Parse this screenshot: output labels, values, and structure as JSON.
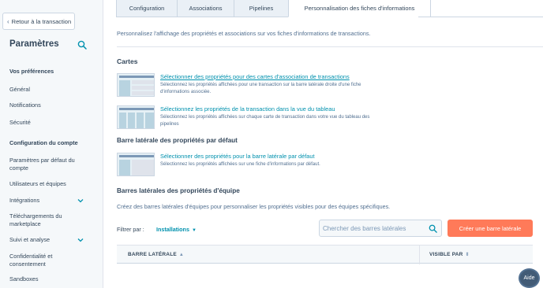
{
  "sidebar": {
    "back_label": "Retour à la transaction",
    "title": "Paramètres",
    "sections": [
      {
        "header": "Vos préférences",
        "items": [
          "Général",
          "Notifications",
          "Sécurité"
        ]
      },
      {
        "header": "Configuration du compte",
        "items": [
          "Paramètres par défaut du compte",
          "Utilisateurs et équipes",
          "Intégrations",
          "Téléchargements du marketplace",
          "Suivi et analyse",
          "Confidentialité et consentement",
          "Sandboxes"
        ]
      }
    ]
  },
  "tabs": [
    "Configuration",
    "Associations",
    "Pipelines",
    "Personnalisation des fiches d'informations"
  ],
  "intro": "Personnalisez l'affichage des propriétés et associations sur vos fiches d'informations de transactions.",
  "cards_section": {
    "title": "Cartes",
    "items": [
      {
        "link": "Sélectionner des propriétés pour des cartes d'association de transactions",
        "desc": "Sélectionnez les propriétés affichées pour une transaction sur la barre latérale droite d'une fiche d'informations associée."
      },
      {
        "link": "Sélectionnez les propriétés de la transaction dans la vue du tableau",
        "desc": "Sélectionnez les propriétés affichées sur chaque carte de transaction dans votre vue du tableau des pipelines"
      }
    ]
  },
  "default_sidebar": {
    "title": "Barre latérale des propriétés par défaut",
    "link": "Sélectionner des propriétés pour la barre latérale par défaut",
    "desc": "Sélectionnez les propriétés affichées sur une fiche d'informations par défaut."
  },
  "team_sidebars": {
    "title": "Barres latérales des propriétés d'équipe",
    "desc": "Créez des barres latérales d'équipes pour personnaliser les propriétés visibles pour des équipes spécifiques.",
    "filter_label": "Filtrer par :",
    "filter_value": "Installations",
    "search_placeholder": "Chercher des barres latérales",
    "create_label": "Créer une barre latérale",
    "columns": [
      "BARRE LATÉRALE",
      "VISIBLE PAR"
    ]
  },
  "help_label": "Aide",
  "colors": {
    "accent": "#ff7a59",
    "link": "#0091ae",
    "text": "#33475b",
    "sidebar_bg": "#f5f8fa"
  }
}
